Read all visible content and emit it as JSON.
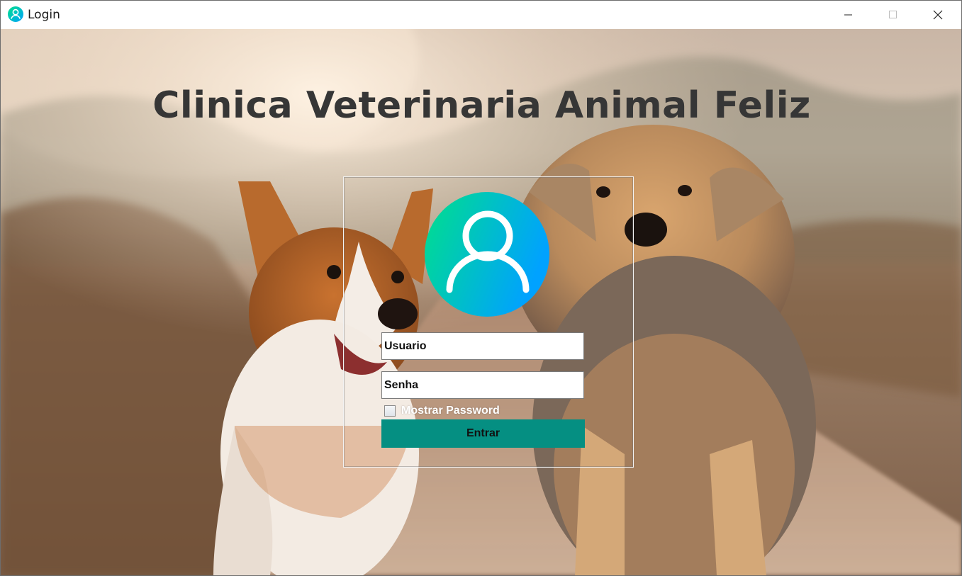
{
  "window": {
    "title": "Login",
    "app_icon": "user-icon",
    "controls": {
      "minimize": "minimize-icon",
      "maximize": "maximize-icon",
      "close": "close-icon"
    }
  },
  "main": {
    "heading": "Clinica Veterinaria Animal Feliz",
    "background": "photo of a corgi and a yorkshire terrier running on a dirt path at sunset",
    "avatar_icon": "user-icon",
    "username": {
      "placeholder": "Usuario"
    },
    "password": {
      "placeholder": "Senha"
    },
    "show_password": {
      "label": "Mostrar Password",
      "checked": false
    },
    "submit": {
      "label": "Entrar"
    }
  },
  "colors": {
    "heading": "#363636",
    "button": "#058f82",
    "avatar_gradient_start": "#00e08a",
    "avatar_gradient_end": "#00a2ff"
  }
}
